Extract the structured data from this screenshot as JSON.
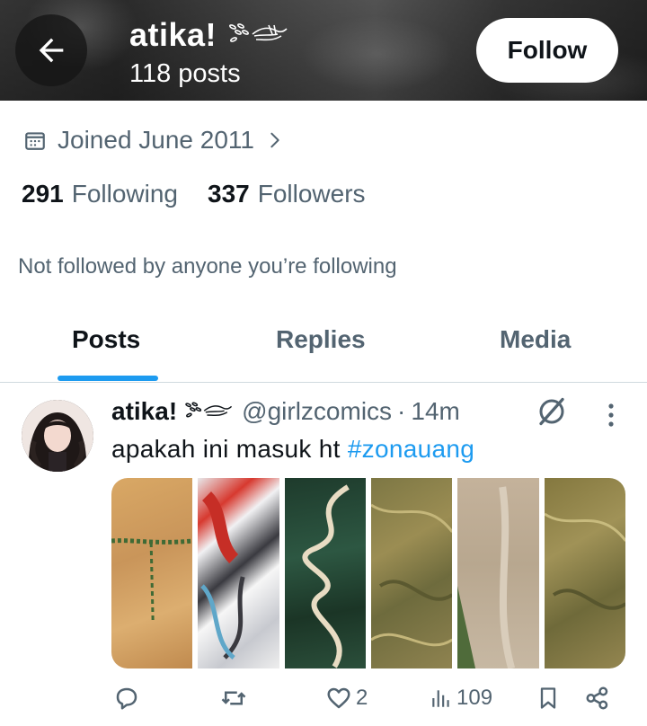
{
  "header": {
    "display_name": "atika!",
    "post_count": "118 posts",
    "follow_label": "Follow"
  },
  "profile": {
    "joined": "Joined June 2011",
    "following_count": "291",
    "following_label": "Following",
    "followers_count": "337",
    "followers_label": "Followers",
    "not_followed_text": "Not followed by anyone you’re following"
  },
  "tabs": [
    {
      "label": "Posts",
      "active": true
    },
    {
      "label": "Replies",
      "active": false
    },
    {
      "label": "Media",
      "active": false
    }
  ],
  "post": {
    "display_name": "atika!",
    "handle": "@girlzcomics",
    "separator": "·",
    "time": "14m",
    "text": "apakah ini masuk ht ",
    "hashtag": "#zonauang",
    "likes": "2",
    "views": "109"
  },
  "colors": {
    "accent": "#1d9bf0",
    "secondary_text": "#536471",
    "primary_text": "#0f1419"
  },
  "icons": [
    "back-arrow-icon",
    "calendar-icon",
    "chevron-right-icon",
    "grok-icon",
    "more-icon",
    "reply-icon",
    "repost-icon",
    "like-icon",
    "views-icon",
    "bookmark-icon",
    "share-icon"
  ]
}
